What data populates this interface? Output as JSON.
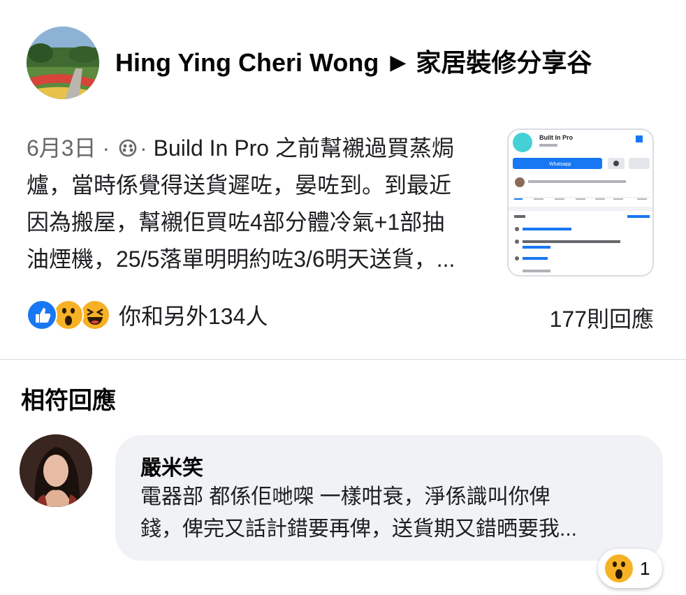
{
  "post": {
    "author": "Hing Ying Cheri Wong",
    "group": "家居裝修分享谷",
    "date": "6月3日",
    "text_lines": [
      "Build In Pro 之前幫襯過買蒸焗",
      "爐，當時係覺得送貨遲咗，晏咗到。到最近",
      "因為搬屋，幫襯佢買咗4部分體冷氣+1部抽",
      "油煙機，25/5落單明明約咗3/6明天送貨，..."
    ],
    "reactions_text": "你和另外134人",
    "comments_count": "177則回應"
  },
  "thumbnail": {
    "page_name": "Built In Pro",
    "action": "Whatsapp"
  },
  "section": {
    "title": "相符回應"
  },
  "comment": {
    "author": "嚴米笑",
    "text_lines": [
      "電器部 都係佢哋㗎 一樣咁衰，淨係識叫你俾",
      "錢，俾完又話計錯要再俾，送貨期又錯晒要我..."
    ],
    "reaction_count": "1"
  },
  "colors": {
    "like": "#1877f2",
    "emoji": "#f7b125",
    "bubble": "#f0f2f5"
  }
}
